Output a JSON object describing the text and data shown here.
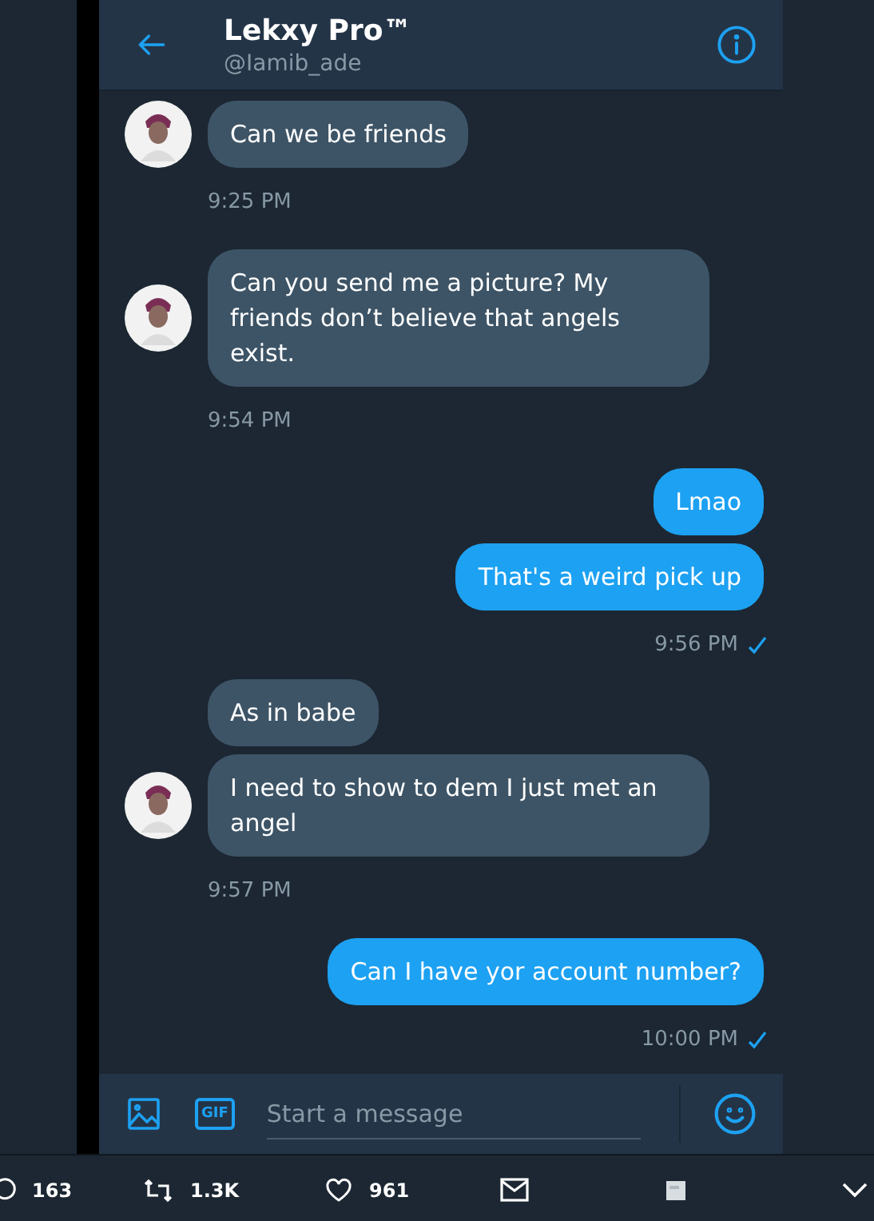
{
  "header": {
    "name": "Lekxy Pro™",
    "handle": "@Iamib_ade"
  },
  "messages": [
    {
      "kind": "incoming",
      "bubbles": [
        "Can we be friends"
      ],
      "time": "9:25 PM"
    },
    {
      "kind": "incoming",
      "bubbles": [
        "Can you send me a picture? My friends don’t believe that angels exist."
      ],
      "time": "9:54 PM"
    },
    {
      "kind": "outgoing",
      "bubbles": [
        "Lmao",
        "That's  a weird pick up"
      ],
      "time": "9:56 PM",
      "seen": true
    },
    {
      "kind": "incoming",
      "bubbles": [
        "As in babe",
        "I need to show to dem I just met an angel"
      ],
      "time": "9:57 PM"
    },
    {
      "kind": "outgoing",
      "bubbles": [
        "Can I have yor account number?"
      ],
      "time": "10:00 PM",
      "seen": true
    }
  ],
  "composer": {
    "gif_label": "GIF",
    "placeholder": "Start a message"
  },
  "tweet_actions": {
    "replies": "163",
    "retweets": "1.3K",
    "likes": "961"
  }
}
